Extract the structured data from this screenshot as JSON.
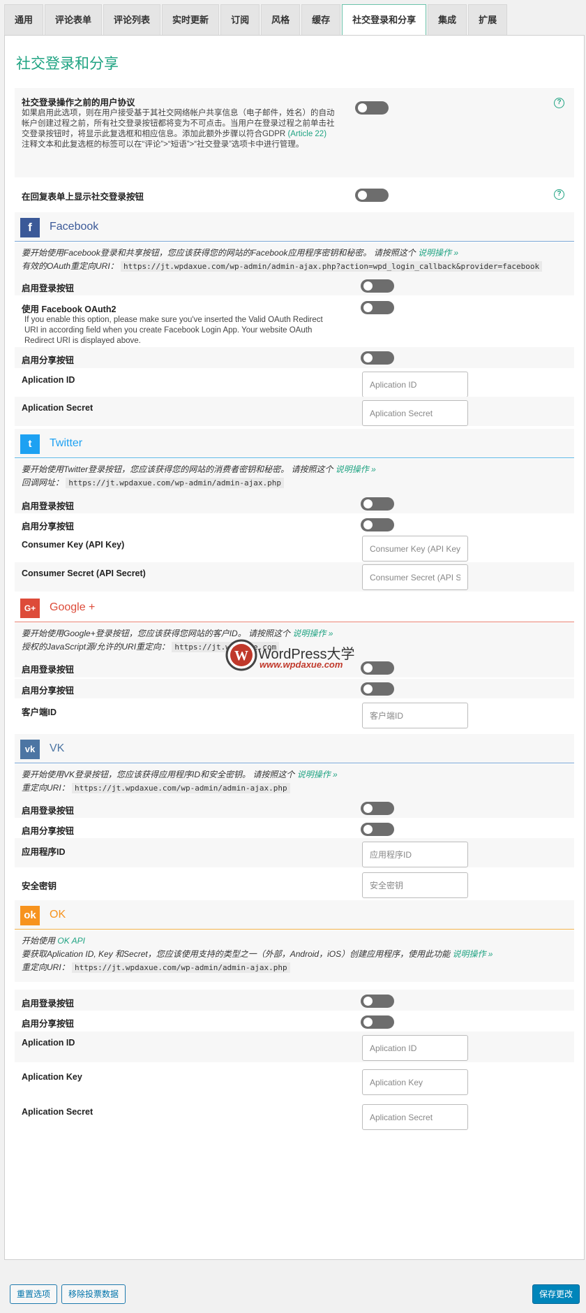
{
  "tabs": [
    "通用",
    "评论表单",
    "评论列表",
    "实时更新",
    "订阅",
    "风格",
    "缓存",
    "社交登录和分享",
    "集成",
    "扩展"
  ],
  "active_tab": "社交登录和分享",
  "page_title": "社交登录和分享",
  "general": {
    "agreement_label": "社交登录操作之前的用户协议",
    "agreement_desc1": "如果启用此选项，则在用户接受基于其社交网络帐户共享信息（电子邮件，姓名）的自动帐户创建过程之前，所有社交登录按钮都将变为不可点击。当用户在登录过程之前单击社交登录按钮时，将显示此复选框和相应信息。添加此额外步骤以符合GDPR",
    "agreement_link": "(Article 22)",
    "agreement_desc2": "注释文本和此复选框的标签可以在“评论”>“短语”>“社交登录”选项卡中进行管理。",
    "reply_form_label": "在回复表单上显示社交登录按钮"
  },
  "facebook": {
    "name": "Facebook",
    "info_line1": "要开始使用Facebook登录和共享按钮，您应该获得您的网站的Facebook应用程序密钥和秘密。 请按照这个",
    "info_link": "说明操作 »",
    "info_line2_label": "有效的OAuth重定向URI：",
    "info_line2_code": "https://jt.wpdaxue.com/wp-admin/admin-ajax.php?action=wpd_login_callback&provider=facebook",
    "enable_login": "启用登录按钮",
    "use_oauth2": "使用 Facebook OAuth2",
    "oauth2_desc": "If you enable this option, please make sure you've inserted the Valid OAuth Redirect URI in according field when you create Facebook Login App. Your website OAuth Redirect URI is displayed above.",
    "enable_share": "启用分享按钮",
    "app_id_label": "Aplication ID",
    "app_id_placeholder": "Aplication ID",
    "app_secret_label": "Aplication Secret",
    "app_secret_placeholder": "Aplication Secret"
  },
  "twitter": {
    "name": "Twitter",
    "info_line1": "要开始使用Twitter登录按钮，您应该获得您的网站的消费者密钥和秘密。 请按照这个",
    "info_link": "说明操作 »",
    "info_line2_label": "回调网址：",
    "info_line2_code": "https://jt.wpdaxue.com/wp-admin/admin-ajax.php",
    "enable_login": "启用登录按钮",
    "enable_share": "启用分享按钮",
    "key_label": "Consumer Key (API Key)",
    "key_placeholder": "Consumer Key (API Key)",
    "secret_label": "Consumer Secret (API Secret)",
    "secret_placeholder": "Consumer Secret (API Secret)"
  },
  "watermark": {
    "title": "WordPress大学",
    "url": "www.wpdaxue.com"
  },
  "google": {
    "name": "Google +",
    "info_line1": "要开始使用Google+登录按钮，您应该获得您网站的客户ID。 请按照这个",
    "info_link": "说明操作 »",
    "info_line2_label": "授权的JavaScript源/允许的URI重定向：",
    "info_line2_code": "https://jt.wpdaxue.com",
    "enable_login": "启用登录按钮",
    "enable_share": "启用分享按钮",
    "client_label": "客户端ID",
    "client_placeholder": "客户端ID"
  },
  "vk": {
    "name": "VK",
    "info_line1": "要开始使用VK登录按钮，您应该获得应用程序ID和安全密钥。 请按照这个",
    "info_link": "说明操作 »",
    "info_line2_label": "重定向URI：",
    "info_line2_code": "https://jt.wpdaxue.com/wp-admin/admin-ajax.php",
    "enable_login": "启用登录按钮",
    "enable_share": "启用分享按钮",
    "app_id_label": "应用程序ID",
    "app_id_placeholder": "应用程序ID",
    "secret_label": "安全密钥",
    "secret_placeholder": "安全密钥"
  },
  "ok": {
    "name": "OK",
    "info_line1_pre": "开始使用",
    "info_line1_link": "OK API",
    "info_line2": "要获取Aplication ID, Key 和Secret，您应该使用支持的类型之一（外部，Android，iOS）创建应用程序，使用此功能",
    "info_link": "说明操作 »",
    "info_line3_label": "重定向URI：",
    "info_line3_code": "https://jt.wpdaxue.com/wp-admin/admin-ajax.php",
    "enable_login": "启用登录按钮",
    "enable_share": "启用分享按钮",
    "app_id_label": "Aplication ID",
    "app_id_placeholder": "Aplication ID",
    "app_key_label": "Aplication Key",
    "app_key_placeholder": "Aplication Key",
    "app_secret_label": "Aplication Secret",
    "app_secret_placeholder": "Aplication Secret"
  },
  "footer": {
    "reset": "重置选项",
    "remove_votes": "移除投票数据",
    "save": "保存更改"
  },
  "colors": {
    "accent": "#1fa382",
    "facebook": "#3b5998",
    "twitter": "#1da1f2",
    "google": "#dd4b39",
    "vk": "#4c75a3",
    "ok": "#f7931e"
  }
}
